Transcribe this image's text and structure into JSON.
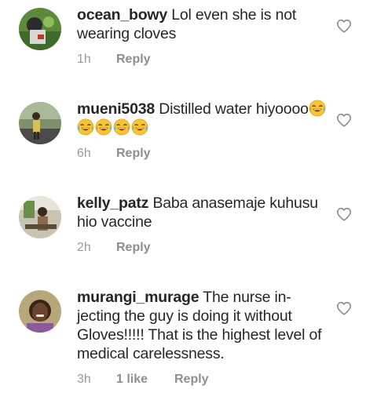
{
  "comments": [
    {
      "username": "ocean_bowy",
      "text": "Lol even she is not wearing cloves",
      "time": "1h",
      "likes": "",
      "reply_label": "Reply",
      "emoji": []
    },
    {
      "username": "mueni5038",
      "text": "Distilled water hiyoooo",
      "time": "6h",
      "likes": "",
      "reply_label": "Reply",
      "emoji": [
        "face-with-tears-of-joy",
        "face-with-tears-of-joy",
        "face-with-tears-of-joy",
        "face-with-tears-of-joy",
        "face-with-tears-of-joy"
      ]
    },
    {
      "username": "kelly_patz",
      "text": "Baba anasemaje kuhusu hio vaccine",
      "time": "2h",
      "likes": "",
      "reply_label": "Reply",
      "emoji": []
    },
    {
      "username": "murangi_murage",
      "text": "The nurse in-jecting the guy is doing it without Gloves!!!!! That is the highest level of medical carelessness.",
      "time": "3h",
      "likes": "1 like",
      "reply_label": "Reply",
      "emoji": []
    }
  ],
  "icons": {
    "like": "heart-outline-icon"
  },
  "colors": {
    "text": "#262626",
    "meta": "#999999",
    "icon": "#8e8e8e"
  }
}
